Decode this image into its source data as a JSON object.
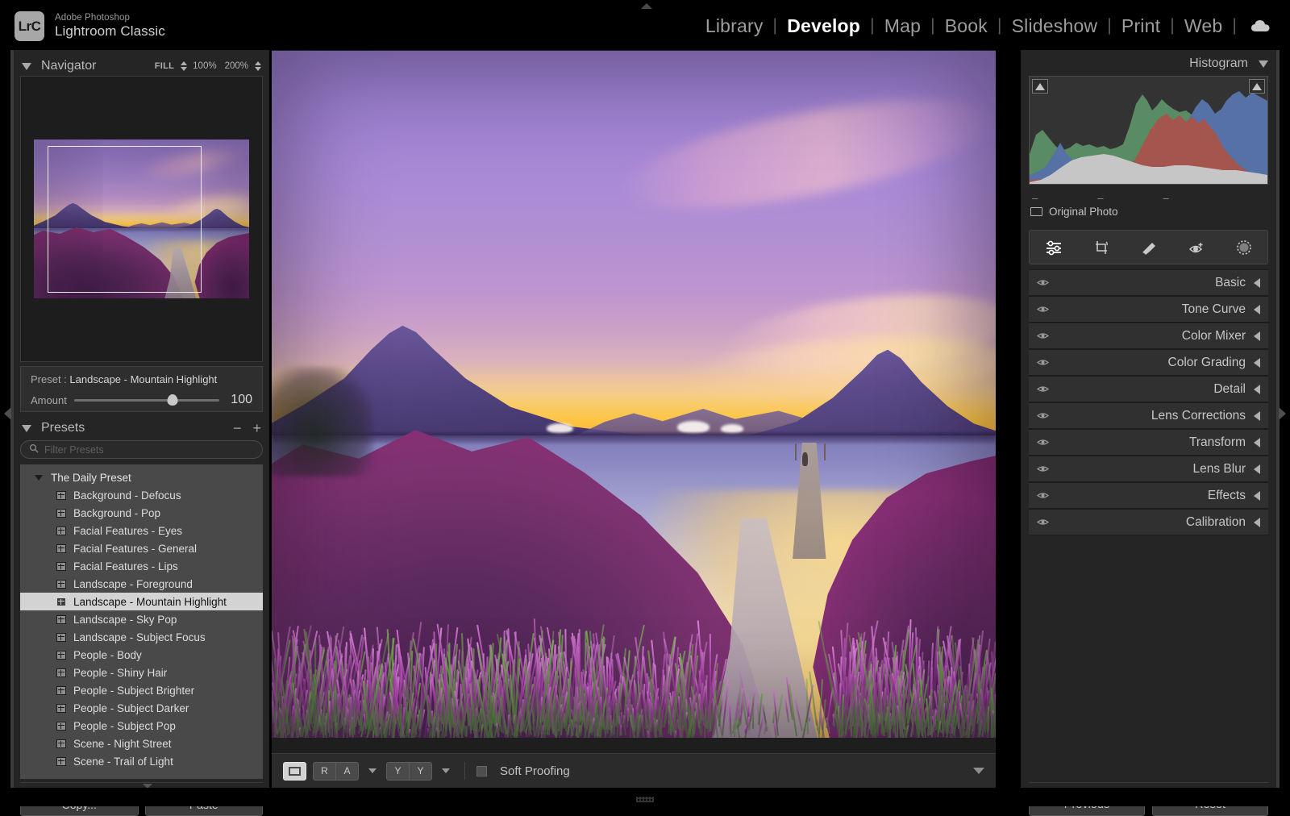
{
  "app": {
    "brand_line1": "Adobe Photoshop",
    "brand_line2": "Lightroom Classic",
    "logo_text": "LrC"
  },
  "modules": {
    "items": [
      {
        "label": "Library",
        "active": false
      },
      {
        "label": "Develop",
        "active": true
      },
      {
        "label": "Map",
        "active": false
      },
      {
        "label": "Book",
        "active": false
      },
      {
        "label": "Slideshow",
        "active": false
      },
      {
        "label": "Print",
        "active": false
      },
      {
        "label": "Web",
        "active": false
      }
    ],
    "separator": "|",
    "cloud_icon": "cloud-icon"
  },
  "navigator": {
    "title": "Navigator",
    "zoom_levels": [
      {
        "label": "FILL",
        "selected": true,
        "has_spinner": true
      },
      {
        "label": "100%",
        "selected": false,
        "has_spinner": false
      },
      {
        "label": "200%",
        "selected": false,
        "has_spinner": true
      }
    ]
  },
  "preset_info": {
    "prefix": "Preset :",
    "name": "Landscape - Mountain Highlight",
    "amount_label": "Amount",
    "amount_value": "100"
  },
  "presets": {
    "title": "Presets",
    "remove_label": "−",
    "add_label": "+",
    "filter_placeholder": "Filter Presets",
    "filter_value": "",
    "group": {
      "name": "The Daily Preset",
      "expanded": true
    },
    "items": [
      {
        "label": "Background - Defocus",
        "selected": false
      },
      {
        "label": "Background - Pop",
        "selected": false
      },
      {
        "label": "Facial Features - Eyes",
        "selected": false
      },
      {
        "label": "Facial Features - General",
        "selected": false
      },
      {
        "label": "Facial Features - Lips",
        "selected": false
      },
      {
        "label": "Landscape - Foreground",
        "selected": false
      },
      {
        "label": "Landscape - Mountain Highlight",
        "selected": true
      },
      {
        "label": "Landscape - Sky Pop",
        "selected": false
      },
      {
        "label": "Landscape - Subject Focus",
        "selected": false
      },
      {
        "label": "People - Body",
        "selected": false
      },
      {
        "label": "People - Shiny Hair",
        "selected": false
      },
      {
        "label": "People - Subject Brighter",
        "selected": false
      },
      {
        "label": "People - Subject Darker",
        "selected": false
      },
      {
        "label": "People - Subject Pop",
        "selected": false
      },
      {
        "label": "Scene - Night Street",
        "selected": false
      },
      {
        "label": "Scene - Trail of Light",
        "selected": false
      }
    ]
  },
  "left_buttons": {
    "copy": "Copy...",
    "paste": "Paste"
  },
  "toolbar": {
    "loupe_label": "■",
    "before_after_label_1": "R",
    "before_after_label_2": "A",
    "compare_label_1": "Y",
    "compare_label_2": "Y",
    "soft_proofing_label": "Soft Proofing",
    "soft_proofing_checked": false
  },
  "histogram": {
    "title": "Histogram",
    "exif": [
      "–",
      "–",
      "–"
    ],
    "original_photo_label": "Original Photo"
  },
  "tools": [
    {
      "name": "edit-sliders-icon",
      "active": true
    },
    {
      "name": "crop-overlay-icon",
      "active": false
    },
    {
      "name": "healing-brush-icon",
      "active": false
    },
    {
      "name": "red-eye-icon",
      "active": false
    },
    {
      "name": "masking-icon",
      "active": false
    }
  ],
  "edit_panels": [
    {
      "label": "Basic"
    },
    {
      "label": "Tone Curve"
    },
    {
      "label": "Color Mixer"
    },
    {
      "label": "Color Grading"
    },
    {
      "label": "Detail"
    },
    {
      "label": "Lens Corrections"
    },
    {
      "label": "Transform"
    },
    {
      "label": "Lens Blur"
    },
    {
      "label": "Effects"
    },
    {
      "label": "Calibration"
    }
  ],
  "right_buttons": {
    "previous": "Previous",
    "reset": "Reset"
  },
  "colors": {
    "panel_bg": "#252525",
    "app_bg": "#000000",
    "accent_text": "#ffffff",
    "selection": "#d3d3d3",
    "hist_red": "#d84a3a",
    "hist_green": "#4f9a5e",
    "hist_blue": "#3f72c8",
    "hist_gray": "#dcdcdc"
  }
}
